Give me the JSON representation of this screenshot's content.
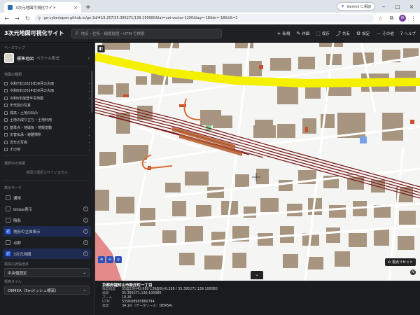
{
  "browser": {
    "tab_title": "3次元地図可視化サイト",
    "tab_close": "×",
    "new_tab": "+",
    "gemini_label": "Gemini に相談",
    "url": "go-cyberjapan.github.io/go-3d/#19.257/35.395271/139.100080&lat=sat-vector-1200&lag=-18&br=-18&tilt=1",
    "profile_initial": "N"
  },
  "app": {
    "title": "3次元地図可視化サイト",
    "search_placeholder": "地名・住所・緯度経度・UTM で検索",
    "actions": [
      {
        "icon": "+",
        "label": "新規"
      },
      {
        "icon": "✎",
        "label": "作図"
      },
      {
        "icon": "⬚",
        "label": "保存"
      },
      {
        "icon": "⤴",
        "label": "共有"
      },
      {
        "icon": "⚙",
        "label": "設定"
      },
      {
        "icon": "⋯",
        "label": "その他"
      },
      {
        "icon": "?",
        "label": "ヘルプ"
      }
    ]
  },
  "sidebar": {
    "basemap_heading": "ベースマップ",
    "basemap_name": "標準地図",
    "basemap_sub": "ベクトル形式",
    "layers_heading": "地図の種類",
    "layers": [
      "令和7年(2025年)8月の大雨",
      "令和6年(2024年)8月の大雨",
      "令和6年能登半島地震",
      "年代別の写真",
      "標高・土地の凹凸",
      "土地の成り立ち・土地利用",
      "基準点・地磁気・地殻変動",
      "災害伝承・避難場所",
      "近年の写真",
      "その他"
    ],
    "selected_heading": "選択中の地図",
    "selected_empty": "地図が選択されていません",
    "display_heading": "表示モード",
    "modes": [
      {
        "label": "通常",
        "checked": false
      },
      {
        "label": "Globe表示",
        "checked": false
      },
      {
        "label": "陰影",
        "checked": false
      },
      {
        "label": "地形の立体表示",
        "checked": true
      },
      {
        "label": "点群",
        "checked": false
      },
      {
        "label": "3次元地図",
        "checked": true
      }
    ],
    "terrain_heading": "標高の誇張倍率",
    "terrain_value": "中央値固定",
    "tile_heading": "標高タイル",
    "tile_value": "DEM5A（5mメッシュ標高）"
  },
  "map": {
    "corner_button": "◧",
    "nav_widgets": [
      "⊕",
      "⊖",
      "◎"
    ],
    "reset_label": "視点リセット",
    "compass": "N",
    "collapse": "⌄"
  },
  "info": {
    "title": "京都府福知山市新庄町一丁目",
    "rows": [
      {
        "k": "緯度経度",
        "v": "35度23分42.980 139度6分0.288 / 35.395271 139.100080"
      },
      {
        "k": "標高",
        "v": "35.395271,139.100080"
      },
      {
        "k": "ズーム",
        "v": "19.26"
      },
      {
        "k": "UTM",
        "v": "53SNU8965860744"
      },
      {
        "k": "標高",
        "v": "34.1m（データソース：DEM5A）"
      }
    ]
  },
  "colors": {
    "road_highlight": "#f5f000",
    "rail": "#7a1a1a",
    "building": "#a89580",
    "accent": "#3a6df0"
  }
}
